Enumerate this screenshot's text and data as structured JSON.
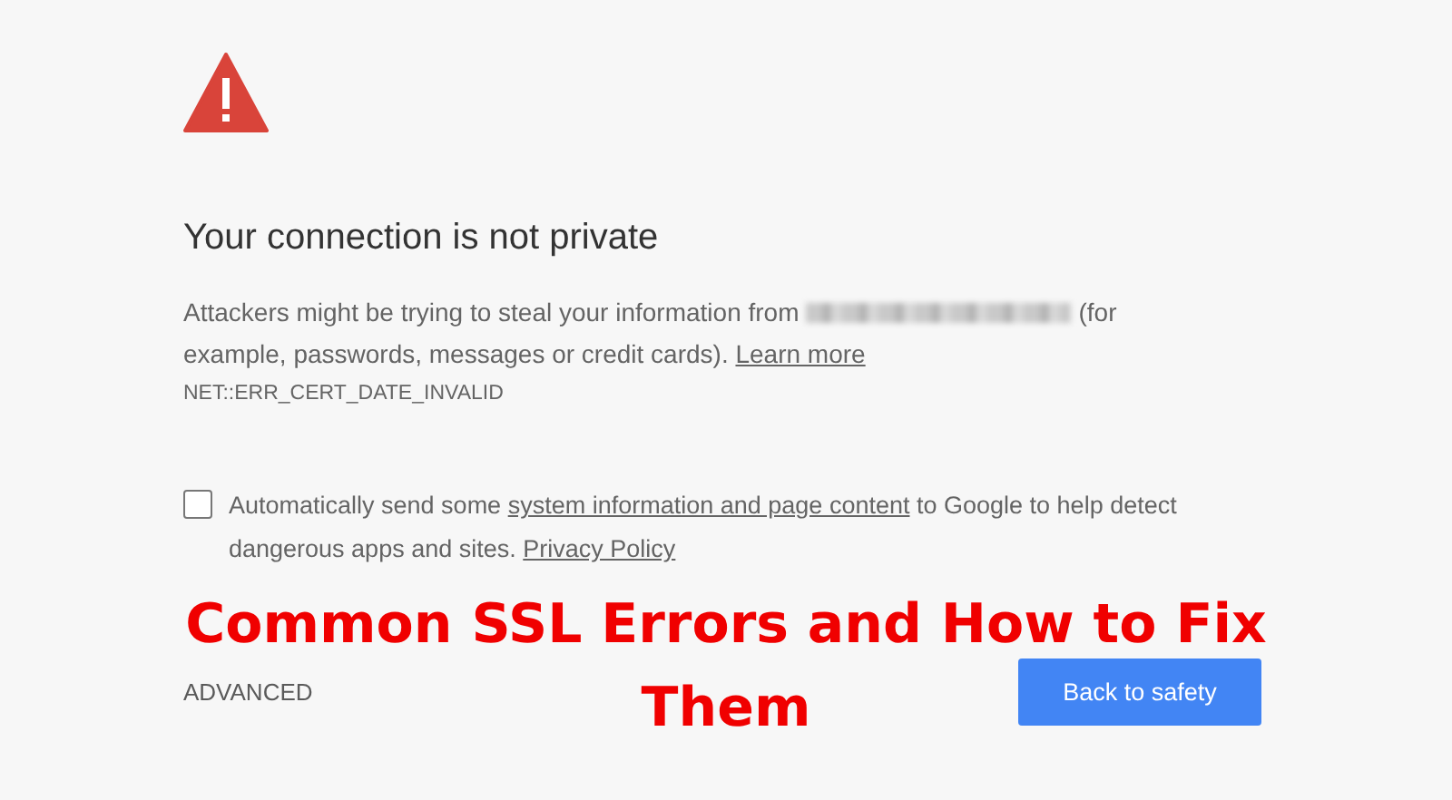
{
  "heading": "Your connection is not private",
  "message": {
    "intro": "Attackers might be trying to steal your information from",
    "domain_blurred": true,
    "rest": "(for example, passwords, messages or credit cards).",
    "link": "Learn more"
  },
  "error_code": "NET::ERR_CERT_DATE_INVALID",
  "report": {
    "checked": false,
    "before": "Automatically send some",
    "link": "system information and page content",
    "after": "to Google to help detect dangerous apps and sites.",
    "policy_link": "Privacy Policy"
  },
  "advanced_button": "ADVANCED",
  "primary_button": "Back to safety",
  "overlay_title_lines": [
    "Common SSL Errors and How to Fix",
    "Them"
  ]
}
